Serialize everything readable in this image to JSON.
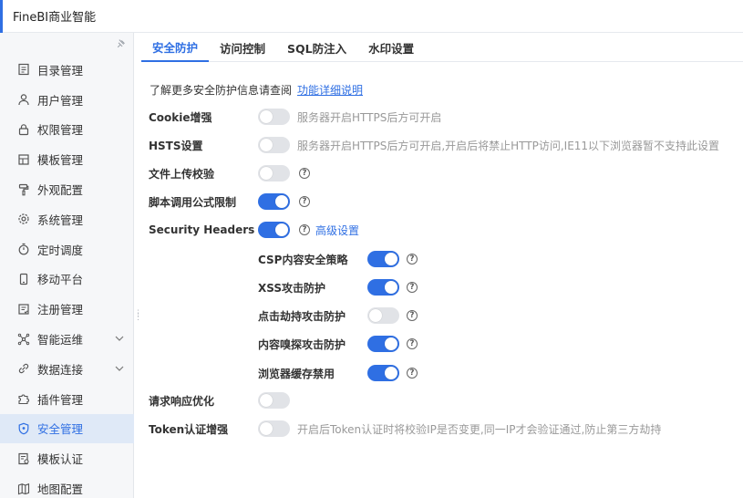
{
  "header": {
    "app_title": "FineBI商业智能"
  },
  "colors": {
    "accent": "#2f6fe3",
    "toggle_off": "#e1e3e7",
    "active_bg": "#dfe9f7",
    "hint": "#999999"
  },
  "sidebar": {
    "pin_icon": "pin-icon",
    "items": [
      {
        "label": "目录管理",
        "icon": "catalog-icon"
      },
      {
        "label": "用户管理",
        "icon": "user-icon"
      },
      {
        "label": "权限管理",
        "icon": "lock-icon"
      },
      {
        "label": "模板管理",
        "icon": "template-icon"
      },
      {
        "label": "外观配置",
        "icon": "paint-roller-icon"
      },
      {
        "label": "系统管理",
        "icon": "gear-icon"
      },
      {
        "label": "定时调度",
        "icon": "stopwatch-icon"
      },
      {
        "label": "移动平台",
        "icon": "mobile-icon"
      },
      {
        "label": "注册管理",
        "icon": "register-icon"
      },
      {
        "label": "智能运维",
        "icon": "ops-icon",
        "expandable": true
      },
      {
        "label": "数据连接",
        "icon": "link-icon",
        "expandable": true
      },
      {
        "label": "插件管理",
        "icon": "puzzle-icon"
      },
      {
        "label": "安全管理",
        "icon": "shield-icon",
        "active": true
      },
      {
        "label": "模板认证",
        "icon": "certificate-icon"
      },
      {
        "label": "地图配置",
        "icon": "map-icon"
      }
    ]
  },
  "tabs": [
    {
      "label": "安全防护",
      "active": true
    },
    {
      "label": "访问控制"
    },
    {
      "label": "SQL防注入"
    },
    {
      "label": "水印设置"
    }
  ],
  "intro": {
    "text": "了解更多安全防护信息请查阅",
    "link": "功能详细说明"
  },
  "settings": {
    "cookie": {
      "label": "Cookie增强",
      "enabled": false,
      "hint": "服务器开启HTTPS后方可开启"
    },
    "hsts": {
      "label": "HSTS设置",
      "enabled": false,
      "hint": "服务器开启HTTPS后方可开启,开启后将禁止HTTP访问,IE11以下浏览器暂不支持此设置"
    },
    "upload": {
      "label": "文件上传校验",
      "enabled": false
    },
    "formula": {
      "label": "脚本调用公式限制",
      "enabled": true
    },
    "security_headers": {
      "label": "Security Headers",
      "enabled": true,
      "advanced_link": "高级设置"
    },
    "csp": {
      "label": "CSP内容安全策略",
      "enabled": true
    },
    "xss": {
      "label": "XSS攻击防护",
      "enabled": true
    },
    "clickjack": {
      "label": "点击劫持攻击防护",
      "enabled": false
    },
    "sniff": {
      "label": "内容嗅探攻击防护",
      "enabled": true
    },
    "cache": {
      "label": "浏览器缓存禁用",
      "enabled": true
    },
    "response": {
      "label": "请求响应优化",
      "enabled": false
    },
    "token": {
      "label": "Token认证增强",
      "enabled": false,
      "hint": "开启后Token认证时将校验IP是否变更,同一IP才会验证通过,防止第三方劫持"
    }
  }
}
